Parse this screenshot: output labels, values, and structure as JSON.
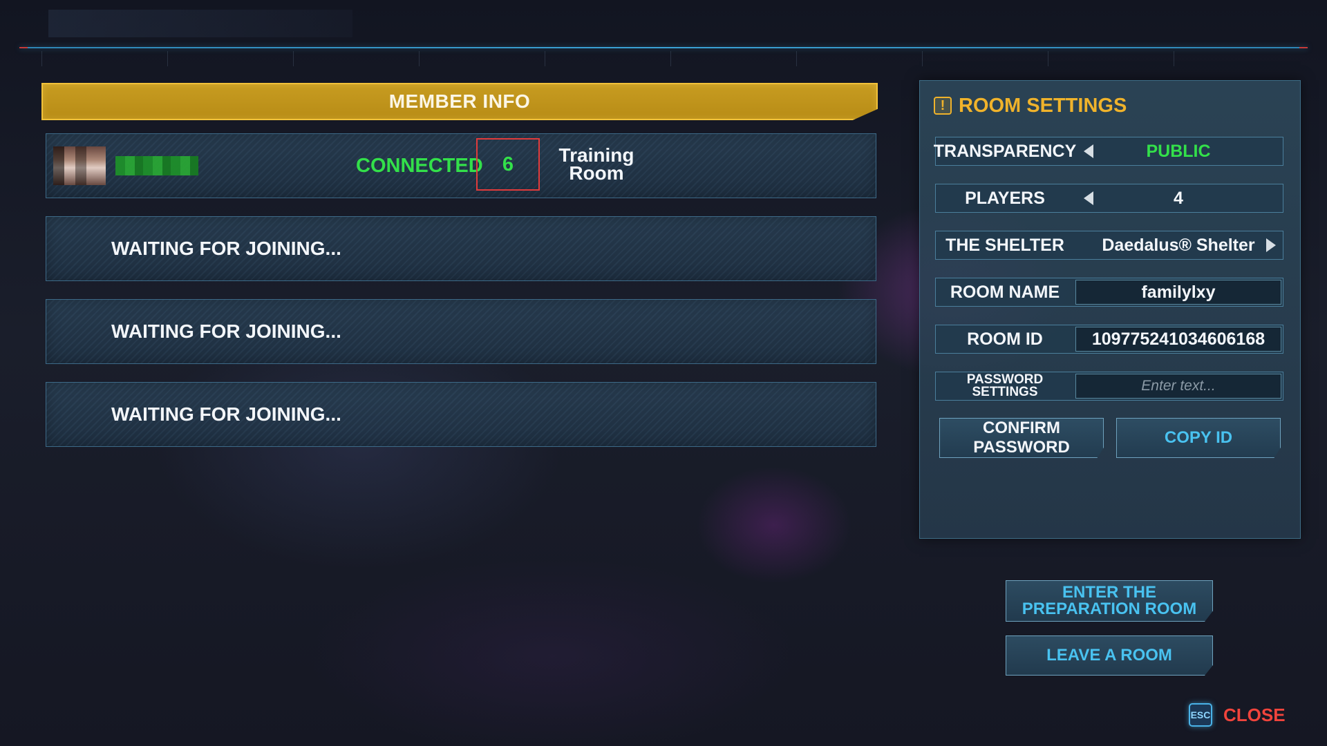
{
  "member_panel": {
    "title": "MEMBER INFO",
    "member": {
      "status": "CONNECTED",
      "level": "6",
      "room_type": "Training Room"
    },
    "waiting_rows": [
      "WAITING FOR JOINING...",
      "WAITING FOR JOINING...",
      "WAITING FOR JOINING..."
    ]
  },
  "room_settings": {
    "title": "ROOM SETTINGS",
    "transparency": {
      "label": "TRANSPARENCY",
      "value": "PUBLIC"
    },
    "players": {
      "label": "PLAYERS",
      "value": "4"
    },
    "shelter": {
      "label": "THE SHELTER",
      "value": "Daedalus® Shelter"
    },
    "room_name": {
      "label": "ROOM NAME",
      "value": "familylxy"
    },
    "room_id": {
      "label": "ROOM ID",
      "value": "1097752410346061​68"
    },
    "password": {
      "label": "PASSWORD SETTINGS",
      "placeholder": "Enter text..."
    },
    "confirm_password_button": "CONFIRM PASSWORD",
    "copy_id_button": "COPY ID"
  },
  "actions": {
    "enter_preparation_room": "ENTER THE PREPARATION ROOM",
    "leave_room": "LEAVE A ROOM"
  },
  "footer": {
    "esc_key": "ESC",
    "close_label": "CLOSE"
  },
  "colors": {
    "accent_gold": "#f0b32b",
    "connected_green": "#33e04a",
    "button_text_blue": "#49c2f0",
    "close_red": "#f0443c"
  }
}
